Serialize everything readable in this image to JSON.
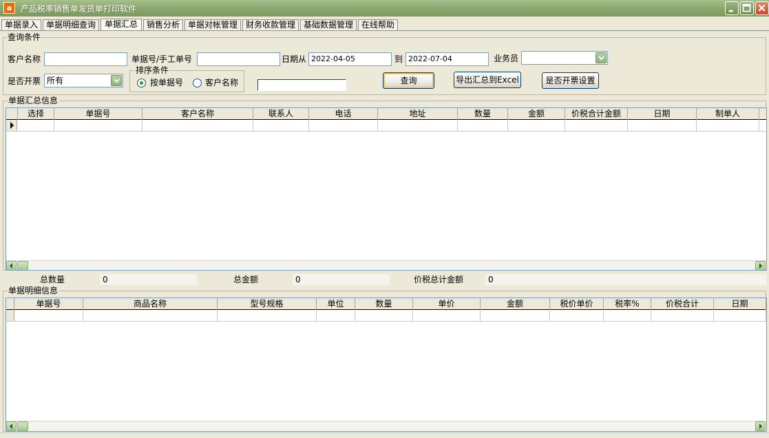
{
  "window": {
    "title": "产品税率销售单发货单打印软件",
    "icon_letter": "a"
  },
  "tabs": [
    {
      "label": "单据录入",
      "active": false
    },
    {
      "label": "单据明细查询",
      "active": false
    },
    {
      "label": "单据汇总",
      "active": true
    },
    {
      "label": "销售分析",
      "active": false
    },
    {
      "label": "单据对帐管理",
      "active": false
    },
    {
      "label": "财务收款管理",
      "active": false
    },
    {
      "label": "基础数据管理",
      "active": false
    },
    {
      "label": "在线帮助",
      "active": false
    }
  ],
  "query": {
    "group_title": "查询条件",
    "customer_label": "客户名称",
    "customer_value": "",
    "docno_label": "单据号/手工单号",
    "docno_value": "",
    "date_from_label": "日期从",
    "date_from": "2022-04-05",
    "date_to_label": "到",
    "date_to": "2022-07-04",
    "salesman_label": "业务员",
    "salesman_value": "",
    "invoice_label": "是否开票",
    "invoice_value": "所有",
    "sort_group_title": "排序条件",
    "sort_by_docno": "按单据号",
    "sort_by_customer": "客户名称",
    "sort_selected": "docno",
    "extra_value": "",
    "search_button": "查询",
    "export_button": "导出汇总到Excel",
    "invoice_settings_button": "是否开票设置"
  },
  "summary": {
    "group_title": "单据汇总信息",
    "columns": [
      "选择",
      "单据号",
      "客户名称",
      "联系人",
      "电话",
      "地址",
      "数量",
      "金额",
      "价税合计金额",
      "日期",
      "制单人"
    ],
    "rows": [
      [
        "",
        "",
        "",
        "",
        "",
        "",
        "",
        "",
        "",
        "",
        ""
      ]
    ]
  },
  "totals": {
    "qty_label": "总数量",
    "qty_value": "0",
    "amount_label": "总金额",
    "amount_value": "0",
    "tax_total_label": "价税总计金额",
    "tax_total_value": "0"
  },
  "detail": {
    "group_title": "单据明细信息",
    "columns": [
      "单据号",
      "商品名称",
      "型号规格",
      "单位",
      "数量",
      "单价",
      "金额",
      "税价单价",
      "税率%",
      "价税合计",
      "日期"
    ],
    "rows": [
      [
        "",
        "",
        "",
        "",
        "",
        "",
        "",
        "",
        "",
        "",
        ""
      ]
    ]
  },
  "colors": {
    "accent_title": "#8CA870",
    "window_bg": "#ECE9D8"
  }
}
